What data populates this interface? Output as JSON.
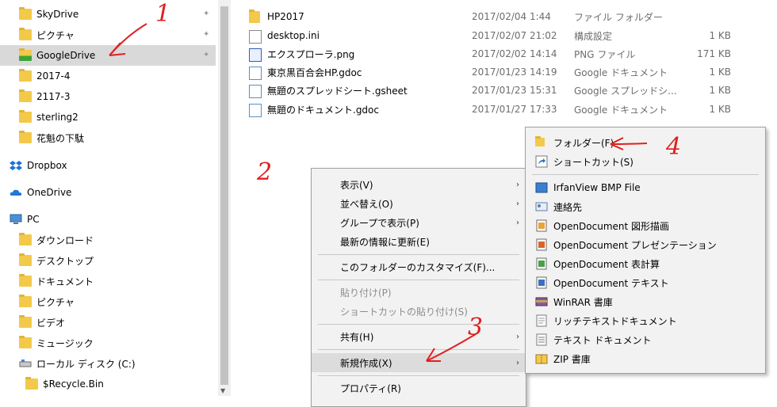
{
  "nav": {
    "items": [
      {
        "label": "SkyDrive",
        "icon": "folder-icon",
        "pinned": true
      },
      {
        "label": "ピクチャ",
        "icon": "folder-icon",
        "pinned": true
      },
      {
        "label": "GoogleDrive",
        "icon": "google-drive-folder-icon",
        "pinned": true,
        "selected": true
      },
      {
        "label": "2017-4",
        "icon": "folder-icon"
      },
      {
        "label": "2117-3",
        "icon": "folder-icon"
      },
      {
        "label": "sterling2",
        "icon": "folder-icon"
      },
      {
        "label": "花魁の下駄",
        "icon": "folder-icon"
      },
      {
        "label": "Dropbox",
        "icon": "dropbox-icon"
      },
      {
        "label": "OneDrive",
        "icon": "onedrive-icon"
      },
      {
        "label": "PC",
        "icon": "pc-icon"
      },
      {
        "label": "ダウンロード",
        "icon": "downloads-icon"
      },
      {
        "label": "デスクトップ",
        "icon": "desktop-icon"
      },
      {
        "label": "ドキュメント",
        "icon": "documents-icon"
      },
      {
        "label": "ピクチャ",
        "icon": "pictures-icon"
      },
      {
        "label": "ビデオ",
        "icon": "videos-icon"
      },
      {
        "label": "ミュージック",
        "icon": "music-icon"
      },
      {
        "label": "ローカル ディスク (C:)",
        "icon": "drive-icon"
      },
      {
        "label": "$Recycle.Bin",
        "icon": "folder-icon"
      }
    ]
  },
  "files": [
    {
      "name": "HP2017",
      "date": "2017/02/04 1:44",
      "type": "ファイル フォルダー",
      "size": "",
      "icon": "folder-icon"
    },
    {
      "name": "desktop.ini",
      "date": "2017/02/07 21:02",
      "type": "構成設定",
      "size": "1 KB",
      "icon": "settings-file-icon"
    },
    {
      "name": "エクスプローラ.png",
      "date": "2017/02/02 14:14",
      "type": "PNG ファイル",
      "size": "171 KB",
      "icon": "image-file-icon"
    },
    {
      "name": "東京黒百合会HP.gdoc",
      "date": "2017/01/23 14:19",
      "type": "Google ドキュメント",
      "size": "1 KB",
      "icon": "gdoc-icon"
    },
    {
      "name": "無題のスプレッドシート.gsheet",
      "date": "2017/01/23 15:31",
      "type": "Google スプレッドシ...",
      "size": "1 KB",
      "icon": "gsheet-icon"
    },
    {
      "name": "無題のドキュメント.gdoc",
      "date": "2017/01/27 17:33",
      "type": "Google ドキュメント",
      "size": "1 KB",
      "icon": "gdoc-icon"
    }
  ],
  "context_menu": {
    "items": [
      {
        "label": "表示(V)",
        "submenu": true
      },
      {
        "label": "並べ替え(O)",
        "submenu": true
      },
      {
        "label": "グループで表示(P)",
        "submenu": true
      },
      {
        "label": "最新の情報に更新(E)"
      },
      {
        "label": "このフォルダーのカスタマイズ(F)..."
      },
      {
        "label": "貼り付け(P)",
        "disabled": true
      },
      {
        "label": "ショートカットの貼り付け(S)",
        "disabled": true
      },
      {
        "label": "共有(H)",
        "submenu": true
      },
      {
        "label": "新規作成(X)",
        "submenu": true,
        "highlighted": true
      },
      {
        "label": "プロパティ(R)"
      }
    ]
  },
  "new_submenu": {
    "items": [
      {
        "label": "フォルダー(F)",
        "icon": "folder-icon"
      },
      {
        "label": "ショートカット(S)",
        "icon": "shortcut-icon"
      },
      {
        "label": "IrfanView BMP File",
        "icon": "irfanview-icon"
      },
      {
        "label": "連絡先",
        "icon": "contact-icon"
      },
      {
        "label": "OpenDocument 図形描画",
        "icon": "opendocument-icon"
      },
      {
        "label": "OpenDocument プレゼンテーション",
        "icon": "opendocument-icon"
      },
      {
        "label": "OpenDocument 表計算",
        "icon": "opendocument-icon"
      },
      {
        "label": "OpenDocument テキスト",
        "icon": "opendocument-icon"
      },
      {
        "label": "WinRAR 書庫",
        "icon": "winrar-icon"
      },
      {
        "label": "リッチテキストドキュメント",
        "icon": "rtf-icon"
      },
      {
        "label": "テキスト ドキュメント",
        "icon": "text-file-icon"
      },
      {
        "label": "ZIP 書庫",
        "icon": "zip-icon"
      }
    ]
  },
  "annotations": {
    "n1": "1",
    "n2": "2",
    "n3": "3",
    "n4": "4",
    "color": "#e02020"
  }
}
